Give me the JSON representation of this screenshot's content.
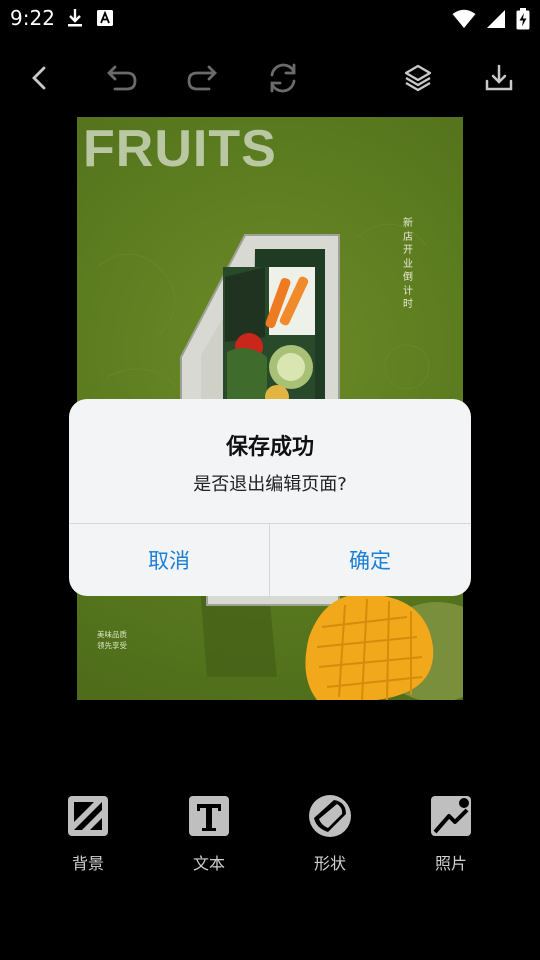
{
  "status": {
    "time": "9:22",
    "icons_left": [
      "download-icon",
      "text-a-icon"
    ],
    "icons_right": [
      "wifi-icon",
      "signal-icon",
      "battery-charging-icon"
    ]
  },
  "toolbar": {
    "buttons": [
      "back-icon",
      "undo-icon",
      "redo-icon",
      "reset-icon",
      "layers-icon",
      "save-download-icon"
    ]
  },
  "poster": {
    "title": "FRUITS",
    "vertical_text": "新店开业倒计时",
    "small_line1": "美味品质",
    "small_line2": "领先享受",
    "number": "4",
    "colors": {
      "background": "#5a7a1f",
      "title": "#b9c7a3",
      "number_frame": "#d7d9d2",
      "mango": "#f1a81a"
    }
  },
  "dialog": {
    "title": "保存成功",
    "message": "是否退出编辑页面?",
    "cancel_label": "取消",
    "ok_label": "确定",
    "accent": "#1a7fd6"
  },
  "bottom_bar": {
    "items": [
      {
        "label": "背景",
        "icon": "background-icon"
      },
      {
        "label": "文本",
        "icon": "text-icon"
      },
      {
        "label": "形状",
        "icon": "shape-icon"
      },
      {
        "label": "照片",
        "icon": "photo-icon"
      }
    ]
  }
}
